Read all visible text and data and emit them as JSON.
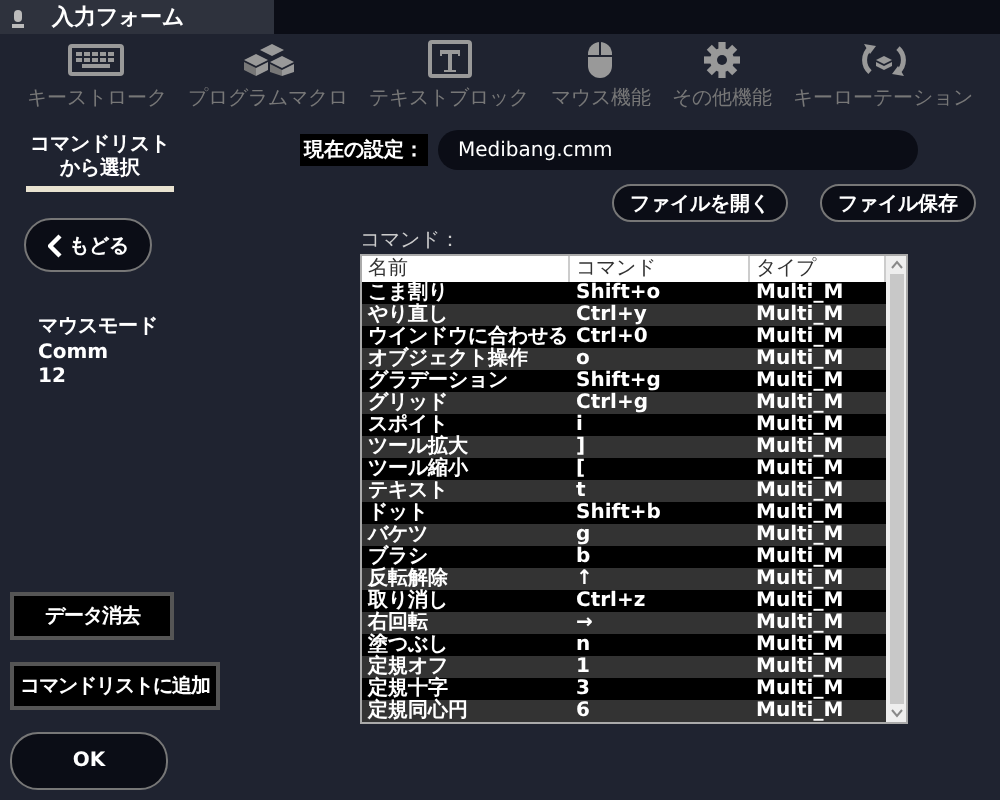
{
  "window": {
    "title": "入力フォーム"
  },
  "toolbar": [
    {
      "kind": "keyboard",
      "label": "キーストローク"
    },
    {
      "kind": "macro",
      "label": "プログラムマクロ"
    },
    {
      "kind": "text",
      "label": "テキストブロック"
    },
    {
      "kind": "mouse",
      "label": "マウス機能"
    },
    {
      "kind": "gear",
      "label": "その他機能"
    },
    {
      "kind": "rotate",
      "label": "キーローテーション"
    }
  ],
  "sidebar": {
    "section_title": [
      "コマンドリスト",
      "から選択"
    ],
    "back_button": "もどる",
    "mode_label": "マウスモード",
    "mode_values": [
      "Comm",
      "12"
    ],
    "clear_button": "データ消去",
    "add_button": "コマンドリストに追加",
    "ok_button": "OK"
  },
  "settings": {
    "label": "現在の設定：",
    "value": "Medibang.cmm",
    "open_button": "ファイルを開く",
    "save_button": "ファイル保存"
  },
  "table": {
    "caption": "コマンド：",
    "columns": [
      "名前",
      "コマンド",
      "タイプ"
    ],
    "rows": [
      [
        "こま割り",
        "Shift+o",
        "Multi_M"
      ],
      [
        "やり直し",
        "Ctrl+y",
        "Multi_M"
      ],
      [
        "ウインドウに合わせる",
        "Ctrl+0",
        "Multi_M"
      ],
      [
        "オブジェクト操作",
        "o",
        "Multi_M"
      ],
      [
        "グラデーション",
        "Shift+g",
        "Multi_M"
      ],
      [
        "グリッド",
        "Ctrl+g",
        "Multi_M"
      ],
      [
        "スポイト",
        "i",
        "Multi_M"
      ],
      [
        "ツール拡大",
        "]",
        "Multi_M"
      ],
      [
        "ツール縮小",
        "[",
        "Multi_M"
      ],
      [
        "テキスト",
        "t",
        "Multi_M"
      ],
      [
        "ドット",
        "Shift+b",
        "Multi_M"
      ],
      [
        "バケツ",
        "g",
        "Multi_M"
      ],
      [
        "ブラシ",
        "b",
        "Multi_M"
      ],
      [
        "反転解除",
        "↑",
        "Multi_M"
      ],
      [
        "取り消し",
        "Ctrl+z",
        "Multi_M"
      ],
      [
        "右回転",
        "→",
        "Multi_M"
      ],
      [
        "塗つぶし",
        "n",
        "Multi_M"
      ],
      [
        "定規オフ",
        "1",
        "Multi_M"
      ],
      [
        "定規十字",
        "3",
        "Multi_M"
      ],
      [
        "定規同心円",
        "6",
        "Multi_M"
      ]
    ]
  }
}
